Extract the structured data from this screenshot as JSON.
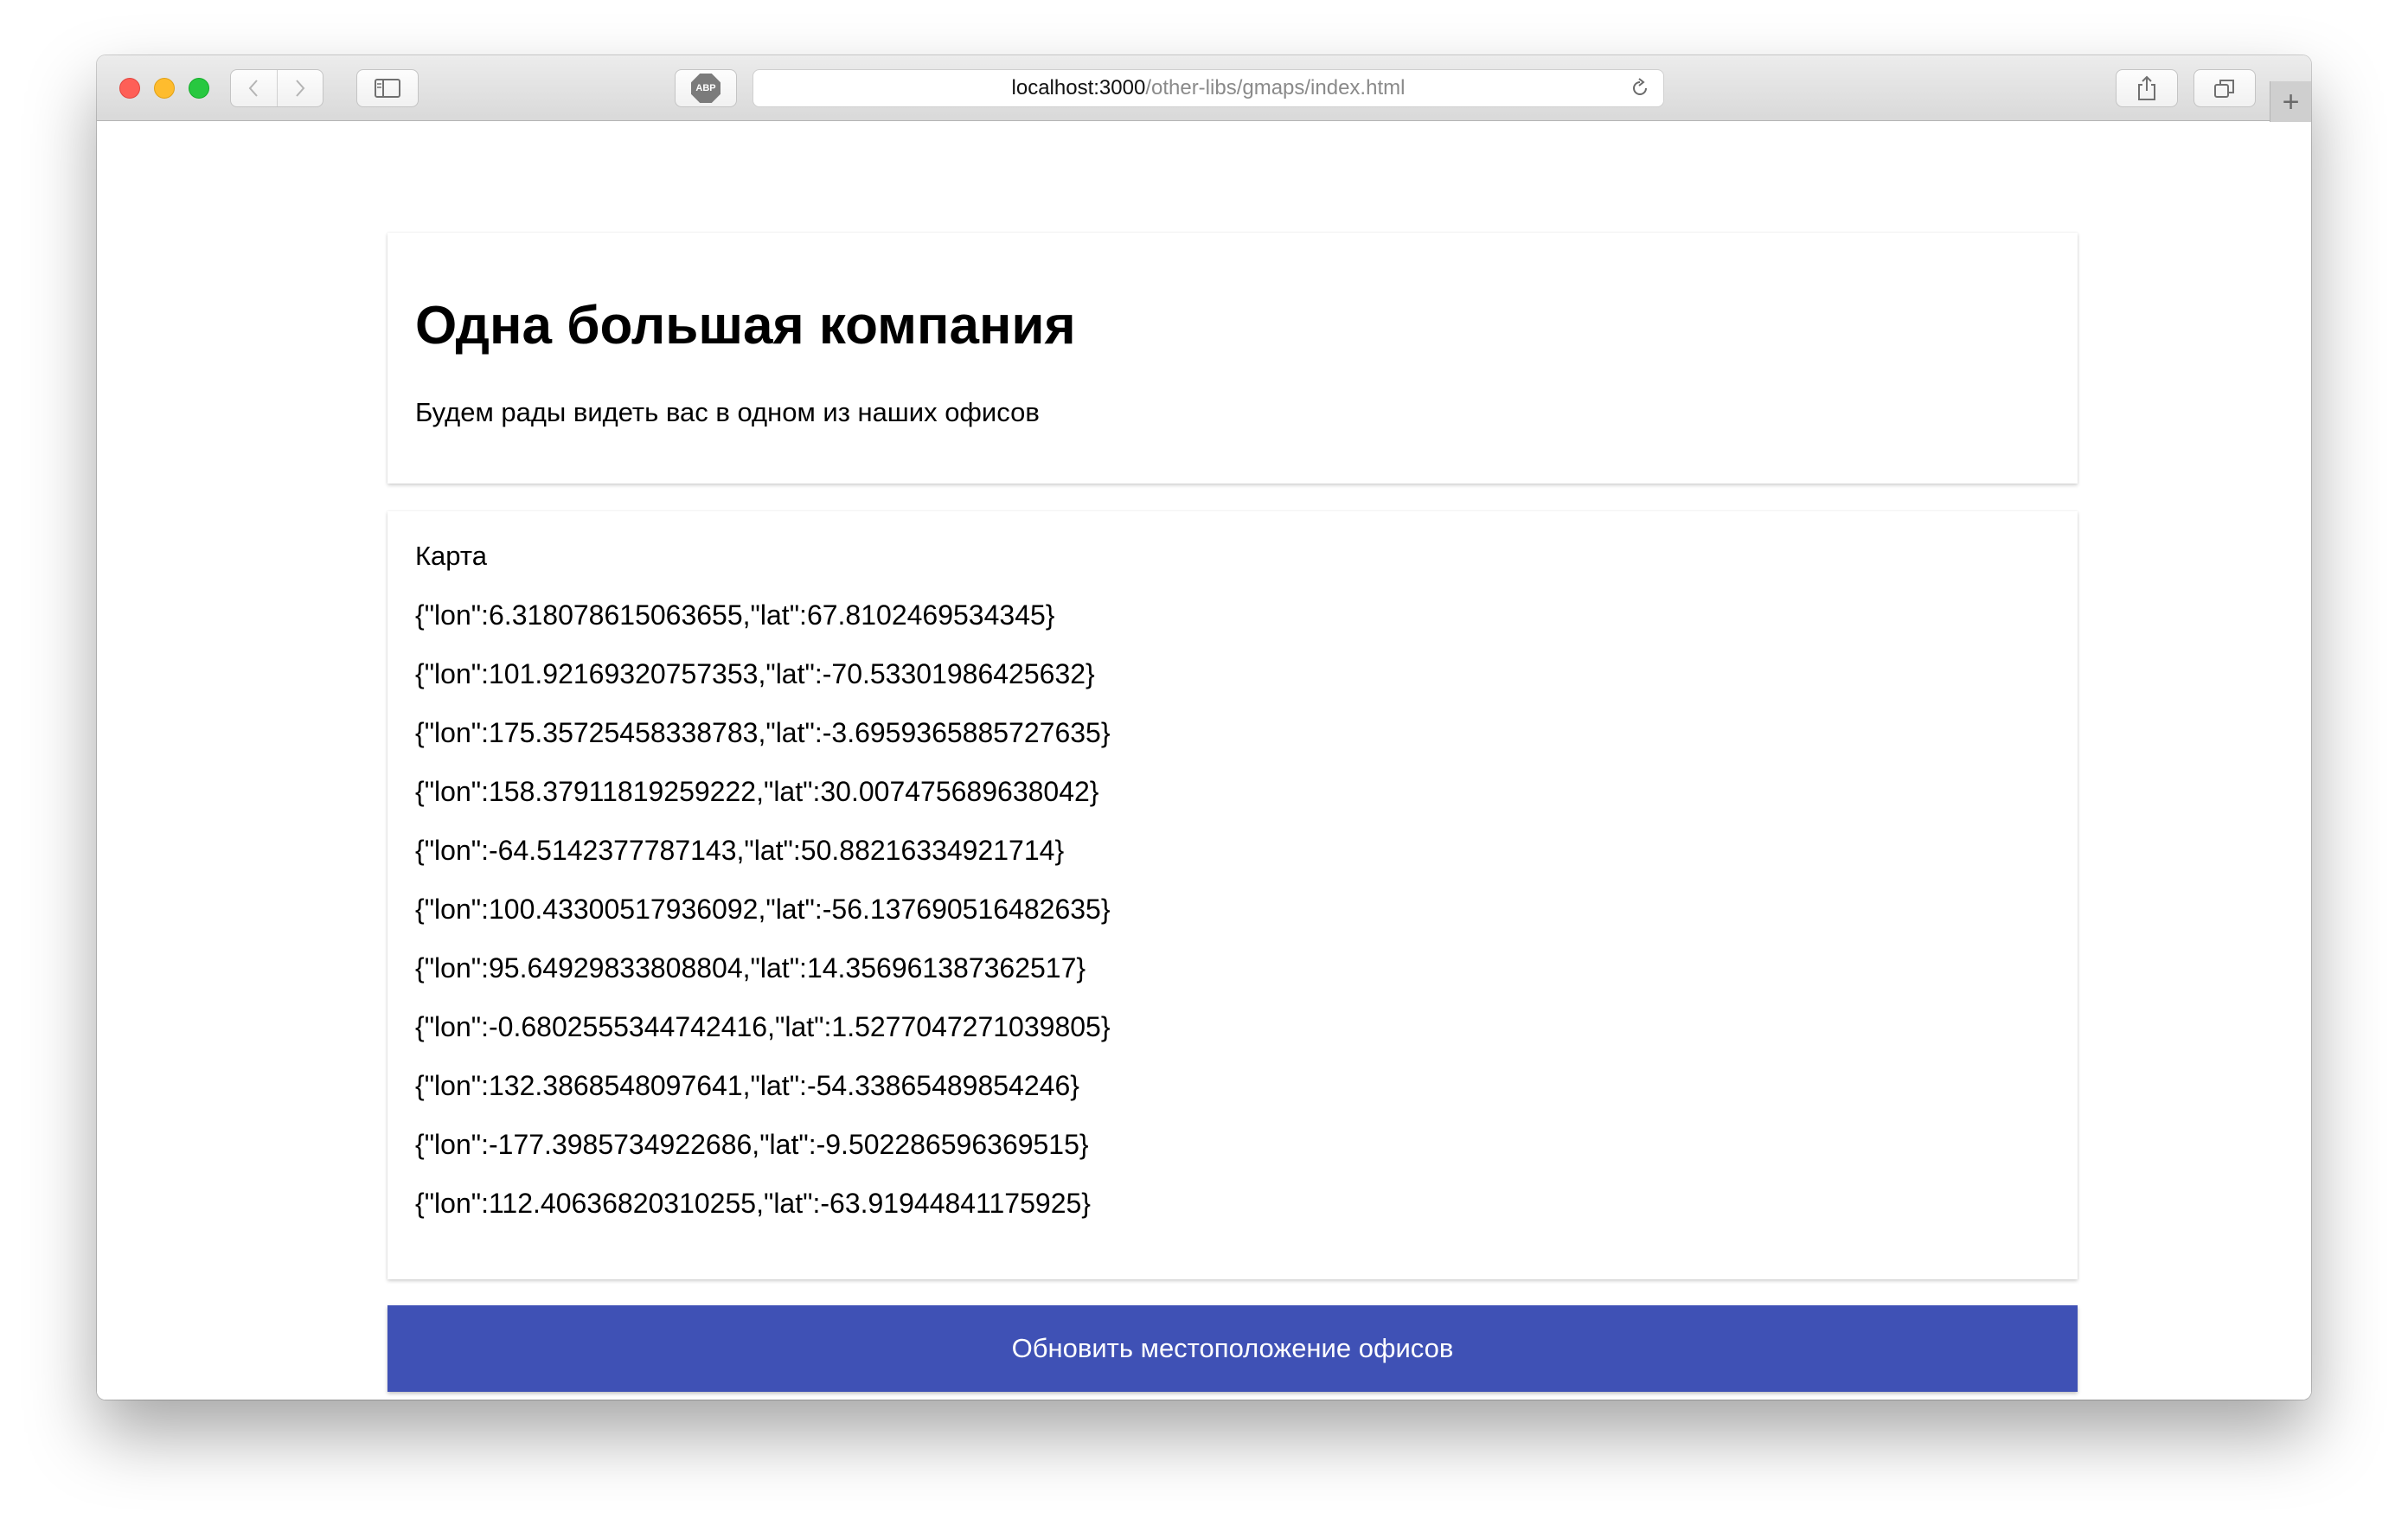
{
  "browser": {
    "url_host": "localhost:3000",
    "url_path": "/other-libs/gmaps/index.html",
    "buttons": {
      "back_icon": "chevron-left-icon",
      "forward_icon": "chevron-right-icon",
      "sidebar_icon": "sidebar-icon",
      "adblock_label": "ABP",
      "reload_icon": "reload-icon",
      "share_icon": "share-icon",
      "tabs_icon": "tabs-icon",
      "new_tab_icon": "plus-icon"
    },
    "traffic_lights": {
      "close": "#fe5f57",
      "minimize": "#febc2e",
      "zoom": "#28c840"
    }
  },
  "page": {
    "title": "Одна большая компания",
    "subtitle": "Будем рады видеть вас в одном из наших офисов",
    "map_label": "Карта",
    "coordinates": [
      "{\"lon\":6.318078615063655,\"lat\":67.8102469534345}",
      "{\"lon\":101.92169320757353,\"lat\":-70.53301986425632}",
      "{\"lon\":175.35725458338783,\"lat\":-3.6959365885727635}",
      "{\"lon\":158.37911819259222,\"lat\":30.007475689638042}",
      "{\"lon\":-64.5142377787143,\"lat\":50.88216334921714}",
      "{\"lon\":100.43300517936092,\"lat\":-56.137690516482635}",
      "{\"lon\":95.64929833808804,\"lat\":14.356961387362517}",
      "{\"lon\":-0.6802555344742416,\"lat\":1.5277047271039805}",
      "{\"lon\":132.3868548097641,\"lat\":-54.33865489854246}",
      "{\"lon\":-177.3985734922686,\"lat\":-9.502286596369515}",
      "{\"lon\":112.40636820310255,\"lat\":-63.91944841175925}"
    ],
    "update_button_label": "Обновить местоположение офисов",
    "accent_color": "#3f51b5"
  }
}
